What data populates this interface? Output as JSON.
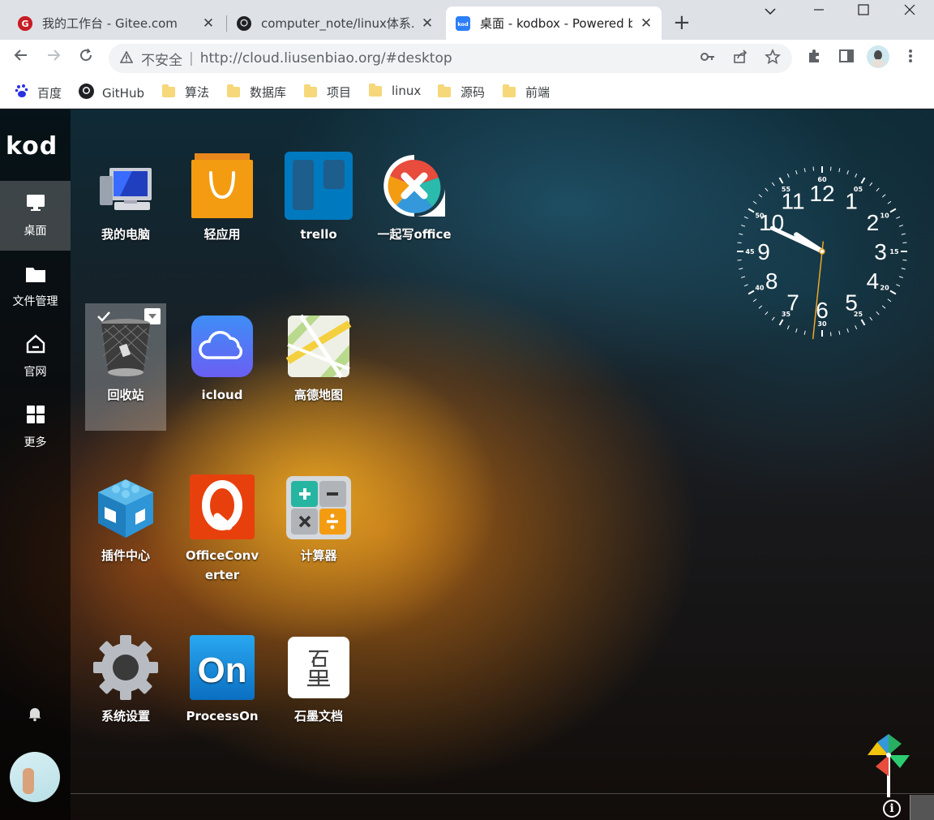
{
  "browser": {
    "tabs": [
      {
        "title": "我的工作台 - Gitee.com",
        "active": false
      },
      {
        "title": "computer_note/linux体系.md",
        "active": false
      },
      {
        "title": "桌面 - kodbox - Powered by",
        "active": true
      }
    ],
    "omnibox": {
      "security_label": "不安全",
      "url": "http://cloud.liusenbiao.org/#desktop"
    },
    "bookmarks": [
      {
        "label": "百度",
        "icon": "baidu-icon"
      },
      {
        "label": "GitHub",
        "icon": "github-icon"
      },
      {
        "label": "算法",
        "icon": "folder-icon"
      },
      {
        "label": "数据库",
        "icon": "folder-icon"
      },
      {
        "label": "项目",
        "icon": "folder-icon"
      },
      {
        "label": "linux",
        "icon": "folder-icon"
      },
      {
        "label": "源码",
        "icon": "folder-icon"
      },
      {
        "label": "前端",
        "icon": "folder-icon"
      }
    ]
  },
  "sidebar": {
    "logo": "kod",
    "items": [
      {
        "label": "桌面",
        "icon": "monitor-icon",
        "active": true
      },
      {
        "label": "文件管理",
        "icon": "folder-icon",
        "active": false
      },
      {
        "label": "官网",
        "icon": "home-icon",
        "active": false
      },
      {
        "label": "更多",
        "icon": "grid-icon",
        "active": false
      }
    ]
  },
  "desktop": {
    "icons": [
      {
        "label": "我的电脑",
        "icon": "computer-icon"
      },
      {
        "label": "轻应用",
        "icon": "shopping-bag-icon"
      },
      {
        "label": "trello",
        "icon": "trello-icon"
      },
      {
        "label": "一起写office",
        "icon": "yiqixie-icon"
      },
      {
        "label": "回收站",
        "icon": "recycle-bin-icon",
        "selected": true
      },
      {
        "label": "icloud",
        "icon": "icloud-icon"
      },
      {
        "label": "高德地图",
        "icon": "map-icon"
      },
      {
        "label": "插件中心",
        "icon": "plugin-cube-icon"
      },
      {
        "label": "OfficeConverter",
        "icon": "office-converter-icon"
      },
      {
        "label": "计算器",
        "icon": "calculator-icon"
      },
      {
        "label": "系统设置",
        "icon": "gear-icon"
      },
      {
        "label": "ProcessOn",
        "icon": "processon-icon"
      },
      {
        "label": "石墨文档",
        "icon": "shimo-icon"
      }
    ]
  },
  "clock": {
    "hours": [
      "12",
      "1",
      "2",
      "3",
      "4",
      "5",
      "6",
      "7",
      "8",
      "9",
      "10",
      "11"
    ],
    "minutes": [
      "60",
      "05",
      "10",
      "15",
      "20",
      "25",
      "30",
      "35",
      "40",
      "45",
      "50",
      "55"
    ],
    "time": "9:50:31"
  },
  "colors": {
    "tabbar": "#dee1e6",
    "accent_orange": "#f39c12",
    "trello_blue": "#0079bf"
  }
}
